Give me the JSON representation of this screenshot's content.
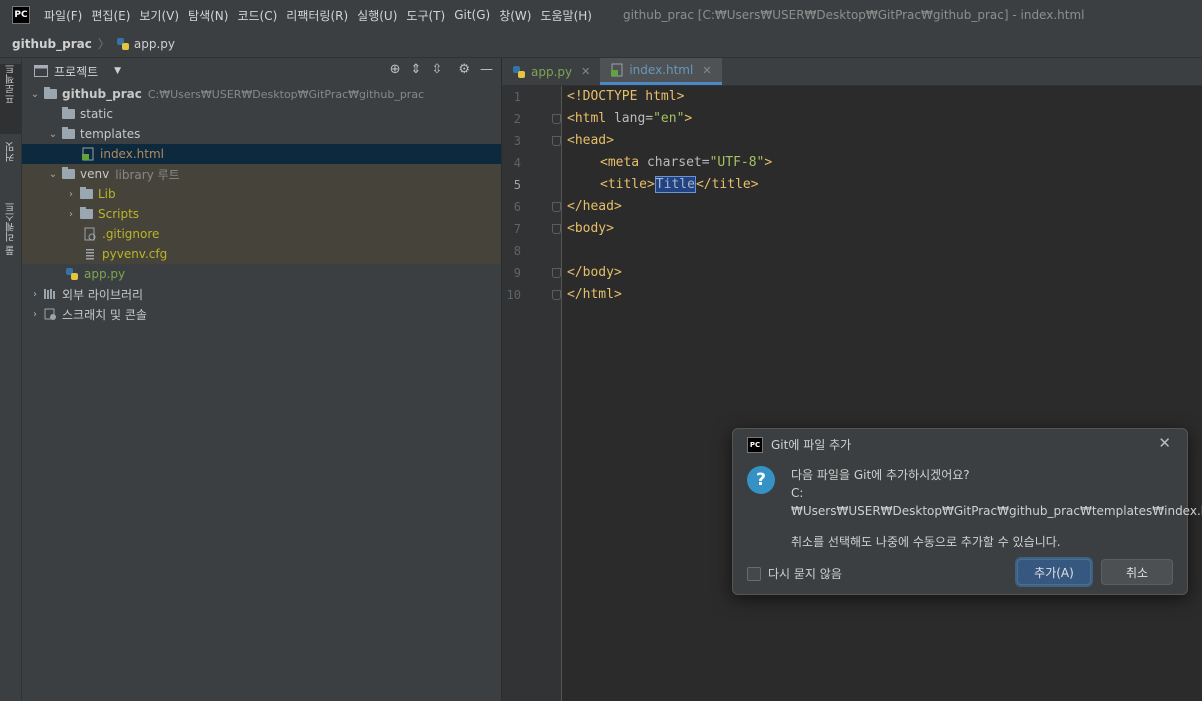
{
  "app": {
    "logo": "PC",
    "window_title": "github_prac [C:₩Users₩USER₩Desktop₩GitPrac₩github_prac] - index.html"
  },
  "menu": [
    "파일(F)",
    "편집(E)",
    "보기(V)",
    "탐색(N)",
    "코드(C)",
    "리팩터링(R)",
    "실행(U)",
    "도구(T)",
    "Git(G)",
    "창(W)",
    "도움말(H)"
  ],
  "breadcrumb": {
    "root": "github_prac",
    "file": "app.py"
  },
  "sidebar_strip": {
    "project": "프로젝트",
    "commit": "커밋",
    "pull_requests": "풀 리퀘스트"
  },
  "project_panel": {
    "title": "프로젝트",
    "tree": [
      {
        "label": "github_prac",
        "extra": "C:₩Users₩USER₩Desktop₩GitPrac₩github_prac"
      },
      {
        "label": "static"
      },
      {
        "label": "templates"
      },
      {
        "label": "index.html"
      },
      {
        "label": "venv",
        "extra": "library 루트"
      },
      {
        "label": "Lib"
      },
      {
        "label": "Scripts"
      },
      {
        "label": ".gitignore"
      },
      {
        "label": "pyvenv.cfg"
      },
      {
        "label": "app.py"
      },
      {
        "label": "외부 라이브러리"
      },
      {
        "label": "스크래치 및 콘솔"
      }
    ]
  },
  "editor": {
    "tabs": [
      "app.py",
      "index.html"
    ],
    "line_numbers": [
      "1",
      "2",
      "3",
      "4",
      "5",
      "6",
      "7",
      "8",
      "9",
      "10"
    ],
    "current_line": 5,
    "code": {
      "l1": "<!DOCTYPE html>",
      "l2_open": "<html",
      "l2_attr": " lang=",
      "l2_val": "\"en\"",
      "l2_close": ">",
      "l3": "<head>",
      "l4_open": "<meta",
      "l4_attr": " charset=",
      "l4_val": "\"UTF-8\"",
      "l4_close": ">",
      "l5_open": "<title>",
      "l5_text": "Title",
      "l5_close": "</title>",
      "l6": "</head>",
      "l7": "<body>",
      "l9": "</body>",
      "l10": "</html>"
    }
  },
  "dialog": {
    "title": "Git에 파일 추가",
    "message": "다음 파일을 Git에 추가하시겠어요?",
    "path": "C:₩Users₩USER₩Desktop₩GitPrac₩github_prac₩templates₩index.html",
    "note": "취소를 선택해도 나중에 수동으로 추가할 수 있습니다.",
    "checkbox": "다시 묻지 않음",
    "add_button": "추가(A)",
    "cancel_button": "취소"
  },
  "colors": {
    "accent": "#4a88c7",
    "selection": "#0d293e",
    "library_bg": "#45433a",
    "primary_button": "#365880"
  }
}
